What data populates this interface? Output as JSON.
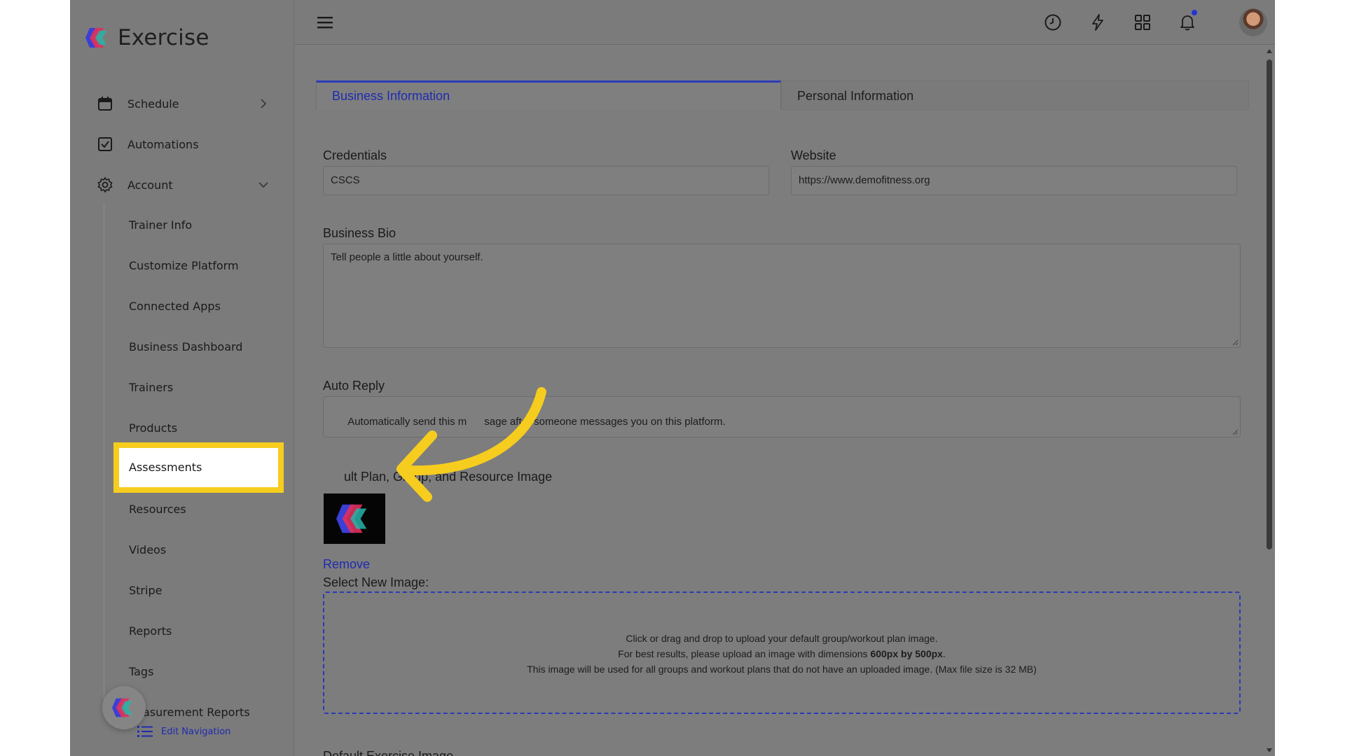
{
  "app": {
    "name": "Exercise"
  },
  "sidebar": {
    "items": [
      {
        "label": "Schedule",
        "icon": "calendar-icon",
        "chevron": "chevron-right-icon"
      },
      {
        "label": "Automations",
        "icon": "checkbox-icon"
      },
      {
        "label": "Account",
        "icon": "gear-icon",
        "chevron": "chevron-down-icon"
      }
    ],
    "account_subitems": [
      "Trainer Info",
      "Customize Platform",
      "Connected Apps",
      "Business Dashboard",
      "Trainers",
      "Products",
      "Assessments",
      "Resources",
      "Videos",
      "Stripe",
      "Reports",
      "Tags",
      "asurement Reports"
    ],
    "active_item": "Assessments",
    "edit_navigation_label": "Edit Navigation"
  },
  "topbar": {
    "icons": [
      "menu-icon",
      "clock-icon",
      "lightning-icon",
      "grid-icon",
      "bell-icon",
      "avatar"
    ]
  },
  "tabs": [
    {
      "label": "Business Information",
      "active": true
    },
    {
      "label": "Personal Information",
      "active": false
    }
  ],
  "form": {
    "credentials": {
      "label": "Credentials",
      "value": "CSCS"
    },
    "website": {
      "label": "Website",
      "value": "https://www.demofitness.org"
    },
    "business_bio": {
      "label": "Business Bio",
      "placeholder": "Tell people a little about yourself."
    },
    "auto_reply": {
      "label": "Auto Reply",
      "placeholder": "Automatically send this m      sage after someone messages you on this platform."
    },
    "default_image": {
      "label": "      ult Plan, Group, and Resource Image",
      "remove_label": "Remove",
      "select_label": "Select New Image:",
      "dropzone_line1": "Click or drag and drop to upload your default group/workout plan image.",
      "dropzone_line2_prefix": "For best results, please upload an image with dimensions ",
      "dropzone_line2_bold": "600px by 500px",
      "dropzone_line2_suffix": ".",
      "dropzone_line3": "This image will be used for all groups and workout plans that do not have an uploaded image. (Max file size is 32 MB)"
    },
    "default_exercise_image_label": "Default Exercise Image"
  },
  "colors": {
    "overlay": "#7d7d7d",
    "accent": "#2a3bb5",
    "highlight": "#f6cd1e",
    "notification_dot": "#2235d6"
  }
}
